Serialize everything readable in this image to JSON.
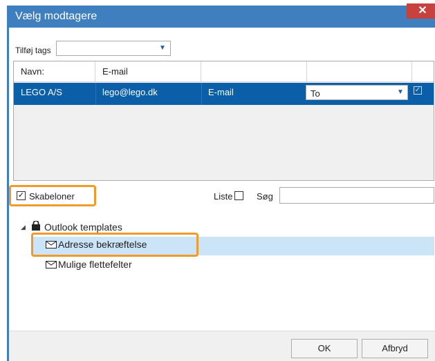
{
  "window": {
    "title": "Vælg modtagere"
  },
  "tags": {
    "label": "Tilføj tags",
    "value": ""
  },
  "grid": {
    "headers": [
      "Navn:",
      "E-mail",
      "",
      ""
    ],
    "rows": [
      {
        "name": "LEGO A/S",
        "email": "lego@lego.dk",
        "type": "E-mail",
        "recipient": "To",
        "checked": true
      }
    ]
  },
  "filter": {
    "templates_label": "Skabeloner",
    "templates_checked": true,
    "list_label": "Liste",
    "search_label": "Søg",
    "search_value": ""
  },
  "tree": {
    "root": "Outlook templates",
    "items": [
      "Adresse bekræftelse",
      "Mulige flettefelter"
    ]
  },
  "buttons": {
    "ok": "OK",
    "cancel": "Afbryd"
  },
  "colors": {
    "titlebar": "#3f7fbf",
    "selection": "#0b5ea8",
    "highlight": "#f09a2a",
    "close": "#c7423f"
  }
}
